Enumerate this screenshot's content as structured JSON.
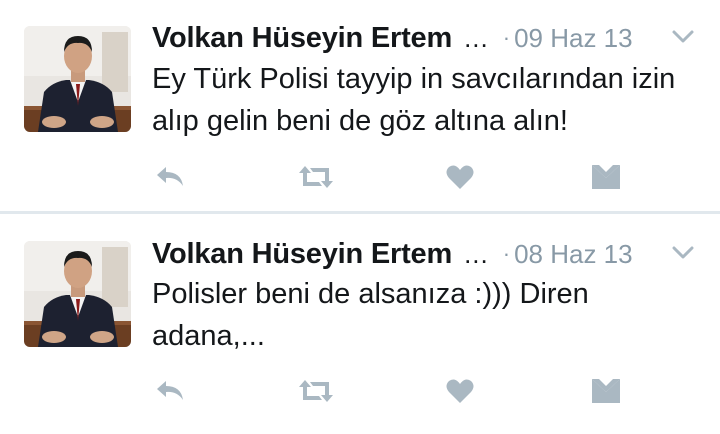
{
  "colors": {
    "text": "#14171a",
    "muted": "#8899a6",
    "icon": "#aab8c2",
    "divider": "#e1e8ed"
  },
  "tweets": [
    {
      "author": "Volkan Hüseyin Ertem",
      "ellipsis": "...",
      "dot": "·",
      "time": "09 Haz 13",
      "text": "Ey Türk Polisi tayyip in savcılarından izin alıp gelin beni de göz altına alın!",
      "icons": [
        "reply-icon",
        "retweet-icon",
        "like-icon",
        "direct-message-icon",
        "chevron-down-icon"
      ]
    },
    {
      "author": "Volkan Hüseyin Ertem",
      "ellipsis": "...",
      "dot": "·",
      "time": "08 Haz 13",
      "text": "Polisler beni de alsanıza :))) Diren adana,...",
      "icons": [
        "reply-icon",
        "retweet-icon",
        "like-icon",
        "direct-message-icon",
        "chevron-down-icon"
      ]
    }
  ]
}
